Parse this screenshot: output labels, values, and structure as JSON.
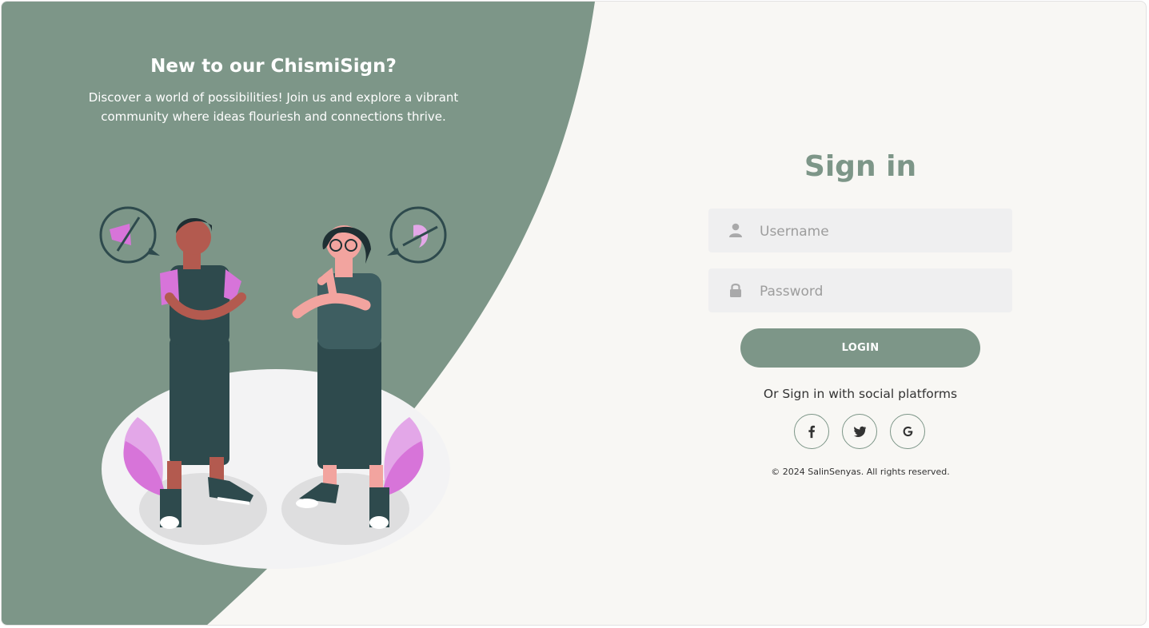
{
  "colors": {
    "accent": "#7d9688",
    "panel_bg": "#f8f7f4",
    "field_bg": "#efeff0",
    "illustration_pink": "#d774d9",
    "illustration_dark": "#2e4a4d"
  },
  "promo": {
    "title": "New to our ChismiSign?",
    "text": "Discover a world of possibilities! Join us and explore a vibrant community where ideas flouriesh and connections thrive."
  },
  "signin": {
    "title": "Sign in",
    "username": {
      "placeholder": "Username",
      "value": "",
      "icon": "user-icon"
    },
    "password": {
      "placeholder": "Password",
      "value": "",
      "icon": "lock-icon"
    },
    "login_label": "LOGIN",
    "social_text": "Or Sign in with social platforms",
    "social": [
      {
        "name": "facebook",
        "icon": "facebook-icon"
      },
      {
        "name": "twitter",
        "icon": "twitter-icon"
      },
      {
        "name": "google",
        "icon": "google-icon"
      }
    ],
    "copyright": "© 2024 SalinSenyas. All rights reserved."
  }
}
